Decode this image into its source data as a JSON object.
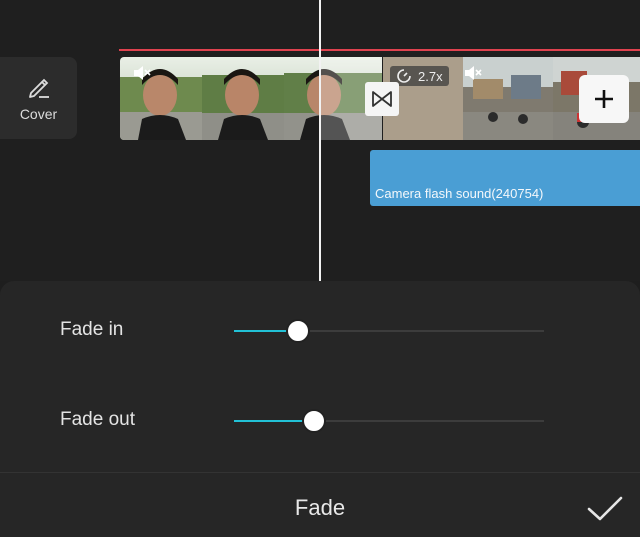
{
  "cover": {
    "label": "Cover",
    "icon": "pencil-icon"
  },
  "clips": {
    "clip1": {
      "mute_icon": "mute-icon"
    },
    "clip2": {
      "mute_icon": "mute-icon",
      "speed_label": "2.7x",
      "speed_icon": "speed-gauge-icon"
    }
  },
  "transition": {
    "icon": "transition-bowtie-icon"
  },
  "add": {
    "icon": "plus-icon"
  },
  "audio": {
    "title": "Camera flash sound(240754)",
    "color": "#4a9ed4"
  },
  "fade_panel": {
    "fade_in": {
      "label": "Fade in",
      "value": 0.2
    },
    "fade_out": {
      "label": "Fade out",
      "value": 0.25
    },
    "accent_color": "#22c1d6"
  },
  "footer": {
    "title": "Fade",
    "confirm_icon": "checkmark-icon"
  }
}
